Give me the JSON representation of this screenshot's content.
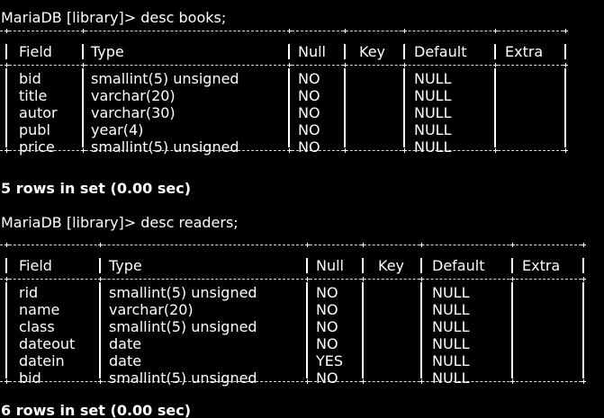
{
  "terminal": {
    "commands": [
      "MariaDB [library]> desc books;",
      "MariaDB [library]> desc readers;"
    ],
    "statuses": [
      "5 rows in set (0.00 sec)",
      "6 rows in set (0.00 sec)"
    ]
  },
  "tables": [
    {
      "name": "books",
      "headers": [
        "Field",
        "Type",
        "Null",
        "Key",
        "Default",
        "Extra"
      ],
      "rows": [
        [
          "bid",
          "smallint(5) unsigned",
          "NO",
          "",
          "NULL",
          ""
        ],
        [
          "title",
          "varchar(20)",
          "NO",
          "",
          "NULL",
          ""
        ],
        [
          "autor",
          "varchar(30)",
          "NO",
          "",
          "NULL",
          ""
        ],
        [
          "publ",
          "year(4)",
          "NO",
          "",
          "NULL",
          ""
        ],
        [
          "price",
          "smallint(5) unsigned",
          "NO",
          "",
          "NULL",
          ""
        ]
      ]
    },
    {
      "name": "readers",
      "headers": [
        "Field",
        "Type",
        "Null",
        "Key",
        "Default",
        "Extra"
      ],
      "rows": [
        [
          "rid",
          "smallint(5) unsigned",
          "NO",
          "",
          "NULL",
          ""
        ],
        [
          "name",
          "varchar(20)",
          "NO",
          "",
          "NULL",
          ""
        ],
        [
          "class",
          "smallint(5) unsigned",
          "NO",
          "",
          "NULL",
          ""
        ],
        [
          "dateout",
          "date",
          "NO",
          "",
          "NULL",
          ""
        ],
        [
          "datein",
          "date",
          "YES",
          "",
          "NULL",
          ""
        ],
        [
          "bid",
          "smallint(5) unsigned",
          "NO",
          "",
          "NULL",
          ""
        ]
      ]
    }
  ]
}
